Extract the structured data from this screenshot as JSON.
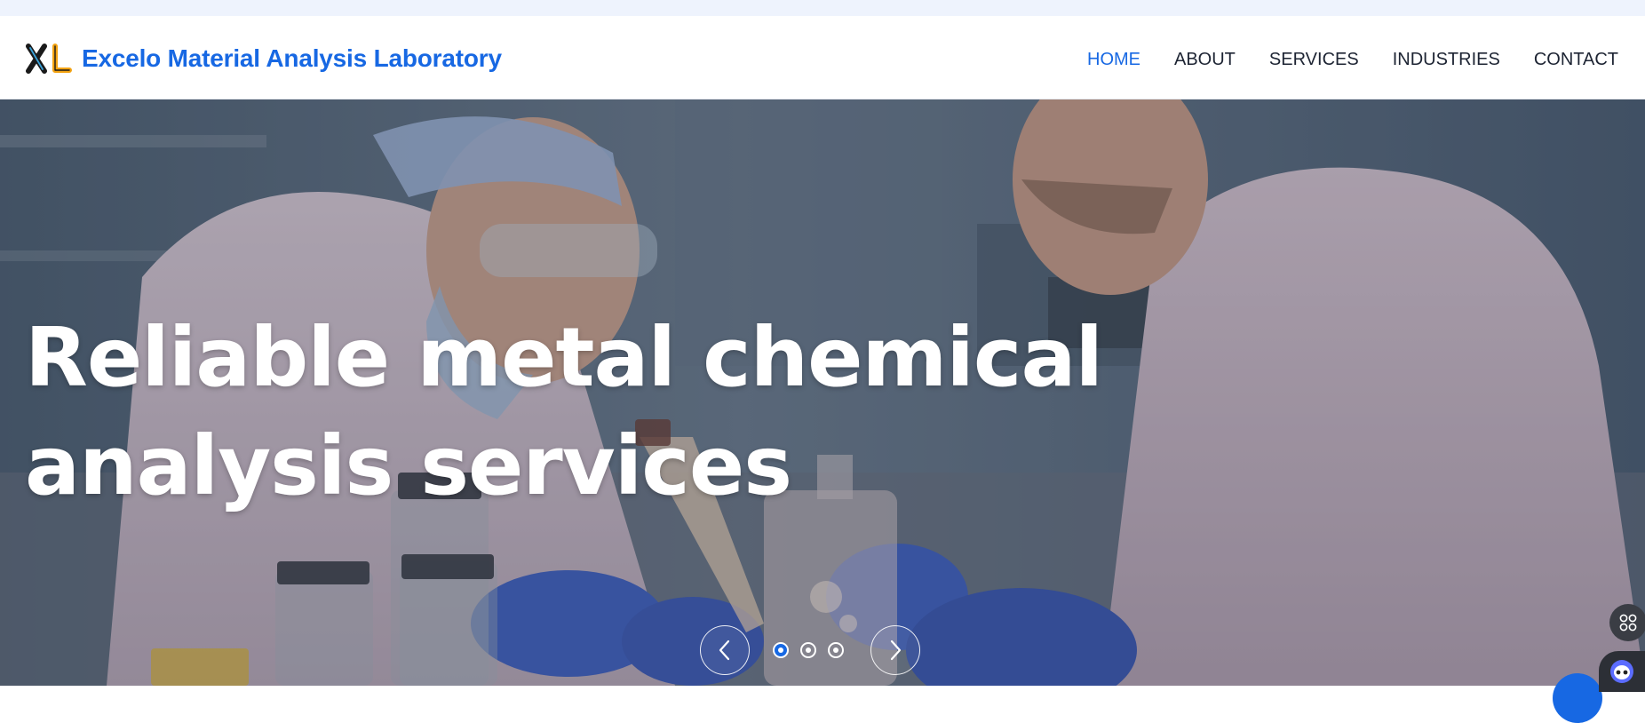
{
  "brand": {
    "name": "Excelo Material Analysis Laboratory",
    "logo_icon": "xl-logo-icon",
    "accent_color": "#1768e3"
  },
  "nav": {
    "items": [
      {
        "label": "HOME",
        "active": true
      },
      {
        "label": "ABOUT",
        "active": false
      },
      {
        "label": "SERVICES",
        "active": false
      },
      {
        "label": "INDUSTRIES",
        "active": false
      },
      {
        "label": "CONTACT",
        "active": false
      }
    ]
  },
  "hero": {
    "title": "Reliable metal chemical analysis services",
    "slide_count": 3,
    "active_slide": 1,
    "prev_icon": "chevron-left-icon",
    "next_icon": "chevron-right-icon"
  },
  "floating": {
    "grid_icon": "apps-grid-icon",
    "bot_icon": "chatbot-icon"
  }
}
